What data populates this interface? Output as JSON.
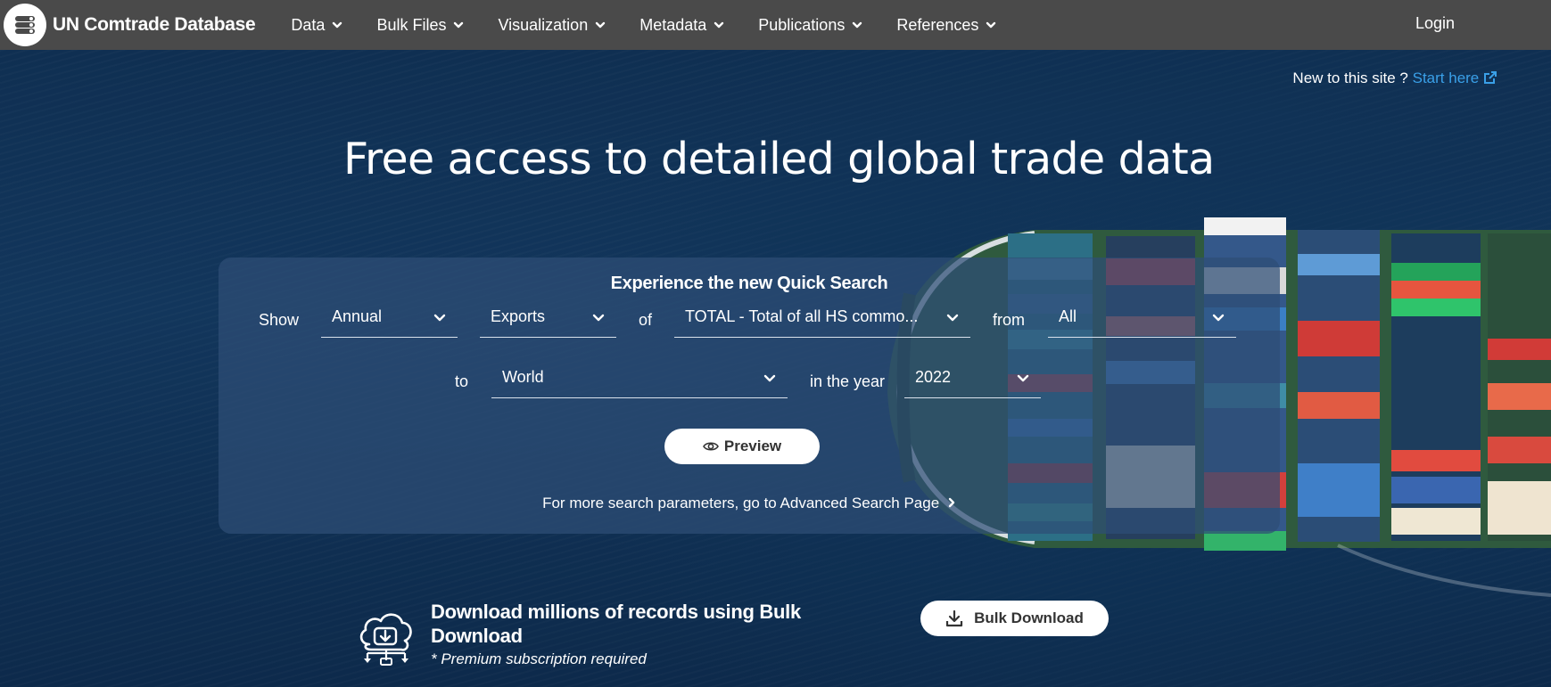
{
  "nav": {
    "brand": "UN Comtrade Database",
    "items": [
      {
        "label": "Data"
      },
      {
        "label": "Bulk Files"
      },
      {
        "label": "Visualization"
      },
      {
        "label": "Metadata"
      },
      {
        "label": "Publications"
      },
      {
        "label": "References"
      }
    ],
    "login": "Login",
    "icons": {
      "logo": "database-logo-icon",
      "menu_caret": "chevron-down-icon"
    }
  },
  "hero": {
    "new_here_label": "New to this site ?",
    "start_link": "Start here",
    "headline": "Free access to detailed global trade data"
  },
  "quick_search": {
    "title": "Experience the new Quick Search",
    "show_label": "Show",
    "of_label": "of",
    "from_label": "from",
    "to_label": "to",
    "year_label": "in the year",
    "frequency": "Annual",
    "flow": "Exports",
    "commodity": "TOTAL - Total of all HS commo...",
    "reporter": "All",
    "partner": "World",
    "year": "2022",
    "preview": "Preview",
    "advanced": "For more search parameters, go to Advanced Search Page"
  },
  "bulk": {
    "title": "Download millions of records using Bulk Download",
    "note": "* Premium subscription required",
    "button": "Bulk Download"
  },
  "colors": {
    "nav_bg": "#4a4a4a",
    "link": "#3aa0e8",
    "sea": "#12365c",
    "panel": "#2e4e76"
  }
}
